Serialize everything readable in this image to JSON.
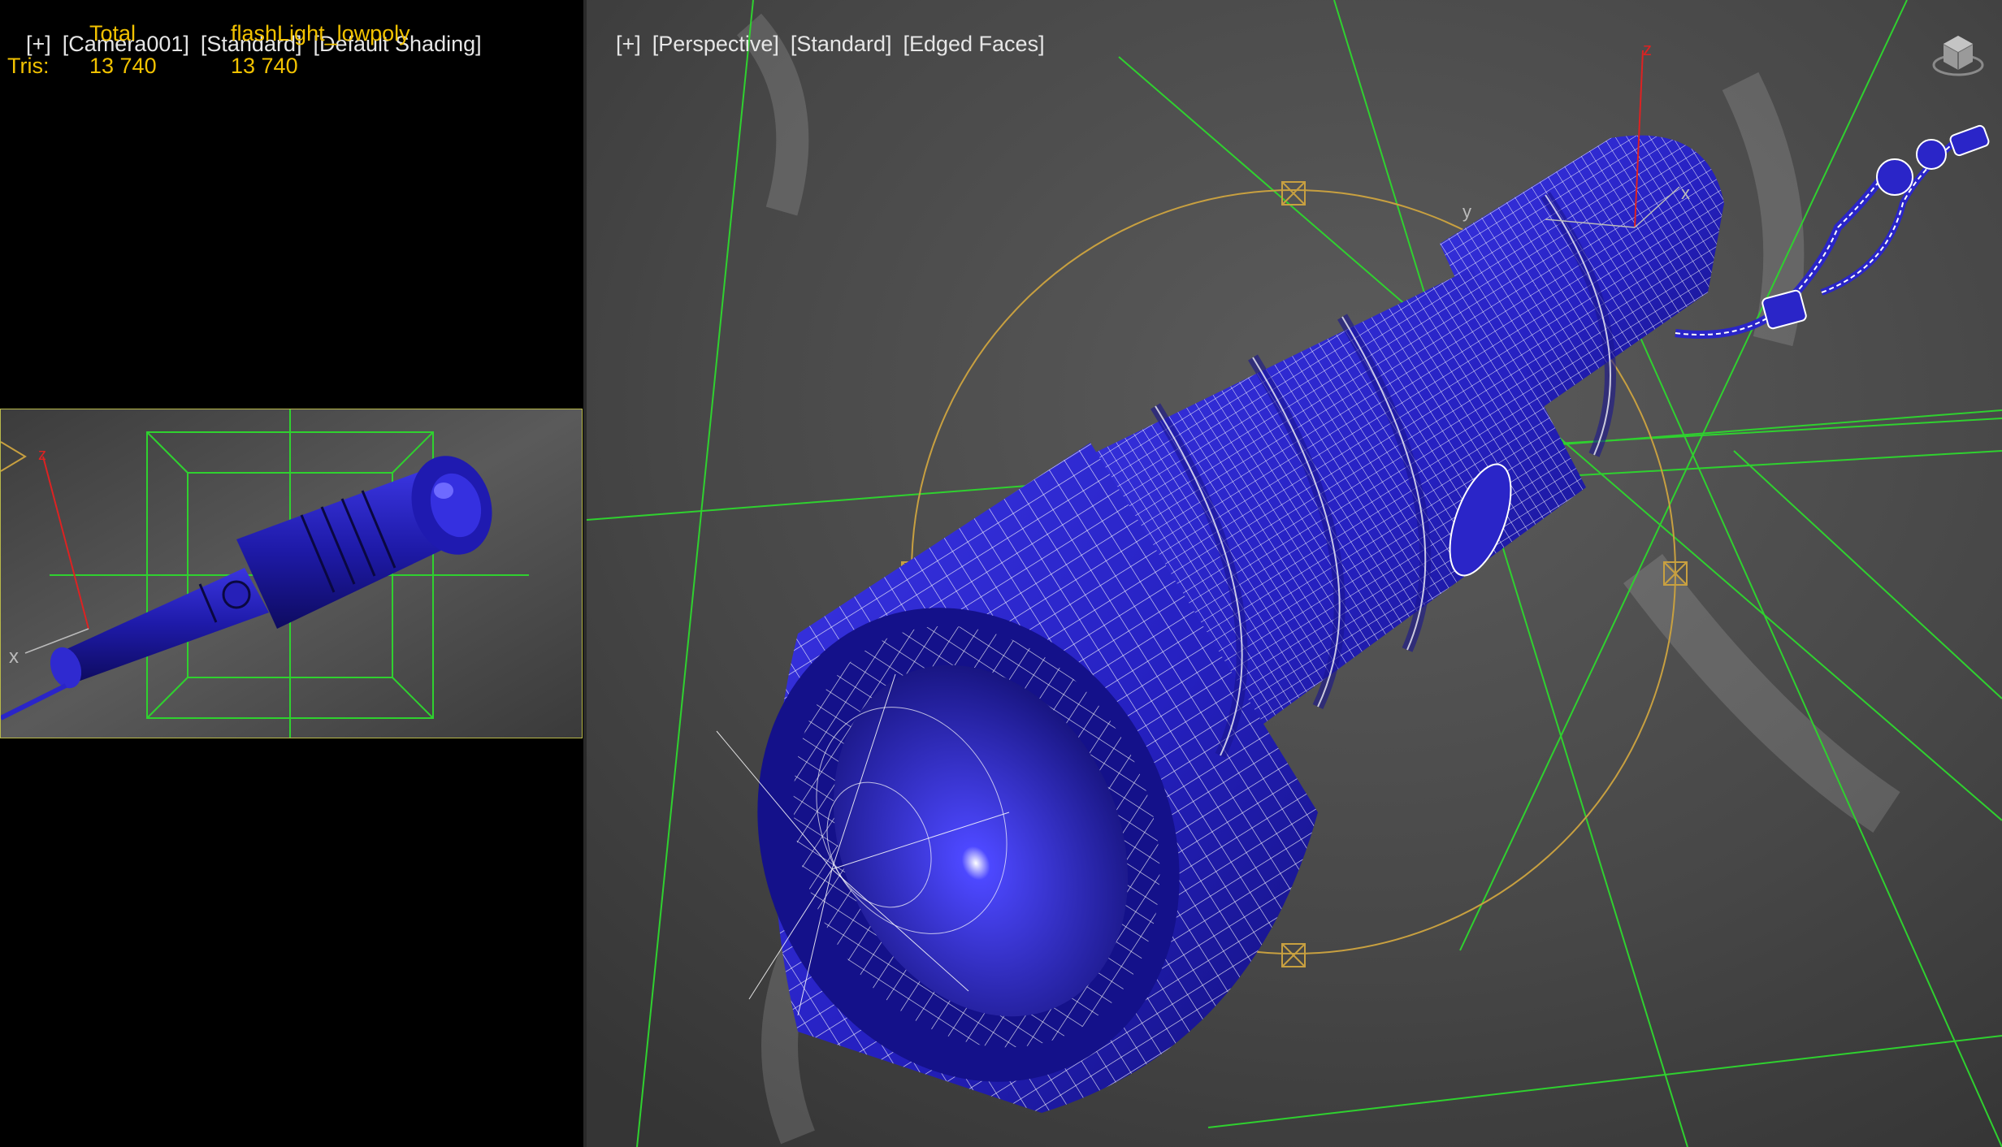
{
  "left_viewport": {
    "label": [
      "[+]",
      "[Camera001]",
      "[Standard]",
      "[Default Shading]"
    ],
    "stats": {
      "col_total": "Total",
      "col_object": "flashLight_lowpoly",
      "row_label": "Tris:",
      "total_value": "13 740",
      "object_value": "13 740"
    }
  },
  "inset_viewport": {
    "axis_z": "z",
    "axis_x": "x"
  },
  "perspective_viewport": {
    "label": [
      "[+]",
      "[Perspective]",
      "[Standard]",
      "[Edged Faces]"
    ],
    "axis_z": "z",
    "axis_y": "y",
    "axis_x": "x"
  },
  "colors": {
    "model_blue": "#2a25c8",
    "wire_white": "#ffffff",
    "stats_yellow": "#f2c200",
    "bbox_green": "#2fd12f",
    "gizmo_gold": "#c8a040"
  }
}
